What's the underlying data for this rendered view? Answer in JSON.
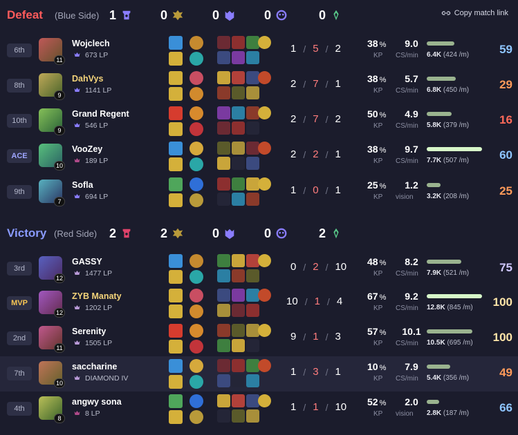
{
  "copy_link_label": "Copy match link",
  "teams": [
    {
      "result": "Defeat",
      "side": "(Blue Side)",
      "result_color": "#ff5b5b",
      "objectives": {
        "towers": "1",
        "dragons": "0",
        "barons": "0",
        "heralds": "0",
        "grubs": "0"
      },
      "players": [
        {
          "rank": "6th",
          "level": "11",
          "name": "Wojclech",
          "lp": "673 LP",
          "kills": "1",
          "deaths": "5",
          "assists": "2",
          "kp_value": "38",
          "kp_unit": "%",
          "kp_label": "KP",
          "cs_value": "9.0",
          "cs_label": "CS/min",
          "damage_total": "6.4K",
          "damage_per_min": "(424 /m)",
          "damage_fraction": 0.5,
          "score": "59",
          "score_color": "#8ec5ff"
        },
        {
          "rank": "8th",
          "level": "9",
          "name": "DahVys",
          "lp": "1141 LP",
          "kills": "2",
          "deaths": "7",
          "assists": "1",
          "kp_value": "38",
          "kp_unit": "%",
          "kp_label": "KP",
          "cs_value": "5.7",
          "cs_label": "CS/min",
          "damage_total": "6.8K",
          "damage_per_min": "(450 /m)",
          "damage_fraction": 0.53,
          "score": "29",
          "score_color": "#ff9a5a"
        },
        {
          "rank": "10th",
          "level": "9",
          "name": "Grand Regent",
          "lp": "546 LP",
          "kills": "2",
          "deaths": "7",
          "assists": "2",
          "kp_value": "50",
          "kp_unit": "%",
          "kp_label": "KP",
          "cs_value": "4.9",
          "cs_label": "CS/min",
          "damage_total": "5.8K",
          "damage_per_min": "(379 /m)",
          "damage_fraction": 0.45,
          "score": "16",
          "score_color": "#ff6a5a"
        },
        {
          "rank": "ACE",
          "level": "10",
          "name": "VooZey",
          "lp": "189 LP",
          "kills": "2",
          "deaths": "2",
          "assists": "1",
          "kp_value": "38",
          "kp_unit": "%",
          "kp_label": "KP",
          "cs_value": "9.7",
          "cs_label": "CS/min",
          "damage_total": "7.7K",
          "damage_per_min": "(507 /m)",
          "damage_fraction": 1.0,
          "score": "60",
          "score_color": "#8ec5ff"
        },
        {
          "rank": "9th",
          "level": "7",
          "name": "Sofla",
          "lp": "694 LP",
          "kills": "1",
          "deaths": "0",
          "assists": "1",
          "kp_value": "25",
          "kp_unit": "%",
          "kp_label": "KP",
          "cs_value": "1.2",
          "cs_label": "vision",
          "damage_total": "3.2K",
          "damage_per_min": "(208 /m)",
          "damage_fraction": 0.25,
          "score": "25",
          "score_color": "#ff9a5a"
        }
      ]
    },
    {
      "result": "Victory",
      "side": "(Red Side)",
      "result_color": "#8a9bff",
      "objectives": {
        "towers": "2",
        "dragons": "2",
        "barons": "0",
        "heralds": "0",
        "grubs": "2"
      },
      "players": [
        {
          "rank": "3rd",
          "level": "12",
          "name": "GASSY",
          "lp": "1477 LP",
          "kills": "0",
          "deaths": "2",
          "assists": "10",
          "kp_value": "48",
          "kp_unit": "%",
          "kp_label": "KP",
          "cs_value": "8.2",
          "cs_label": "CS/min",
          "damage_total": "7.9K",
          "damage_per_min": "(521 /m)",
          "damage_fraction": 0.62,
          "score": "75",
          "score_color": "#cfc8ff"
        },
        {
          "rank": "MVP",
          "level": "12",
          "name": "ZYB Manaty",
          "lp": "1202 LP",
          "kills": "10",
          "deaths": "1",
          "assists": "4",
          "kp_value": "67",
          "kp_unit": "%",
          "kp_label": "KP",
          "cs_value": "9.2",
          "cs_label": "CS/min",
          "damage_total": "12.8K",
          "damage_per_min": "(845 /m)",
          "damage_fraction": 1.0,
          "score": "100",
          "score_color": "#ffe5a8"
        },
        {
          "rank": "2nd",
          "level": "11",
          "name": "Serenity",
          "lp": "1505 LP",
          "kills": "9",
          "deaths": "1",
          "assists": "3",
          "kp_value": "57",
          "kp_unit": "%",
          "kp_label": "KP",
          "cs_value": "10.1",
          "cs_label": "CS/min",
          "damage_total": "10.5K",
          "damage_per_min": "(695 /m)",
          "damage_fraction": 0.82,
          "score": "100",
          "score_color": "#ffe5a8"
        },
        {
          "rank": "7th",
          "level": "10",
          "name": "saccharine",
          "lp": "DIAMOND IV",
          "kills": "1",
          "deaths": "3",
          "assists": "1",
          "kp_value": "10",
          "kp_unit": "%",
          "kp_label": "KP",
          "cs_value": "7.9",
          "cs_label": "CS/min",
          "damage_total": "5.4K",
          "damage_per_min": "(356 /m)",
          "damage_fraction": 0.42,
          "score": "49",
          "score_color": "#ff9a5a"
        },
        {
          "rank": "4th",
          "level": "8",
          "name": "angwy sona",
          "lp": "8 LP",
          "kills": "1",
          "deaths": "1",
          "assists": "10",
          "kp_value": "52",
          "kp_unit": "%",
          "kp_label": "KP",
          "cs_value": "2.0",
          "cs_label": "vision",
          "damage_total": "2.8K",
          "damage_per_min": "(187 /m)",
          "damage_fraction": 0.22,
          "score": "66",
          "score_color": "#8ec5ff"
        }
      ]
    }
  ]
}
